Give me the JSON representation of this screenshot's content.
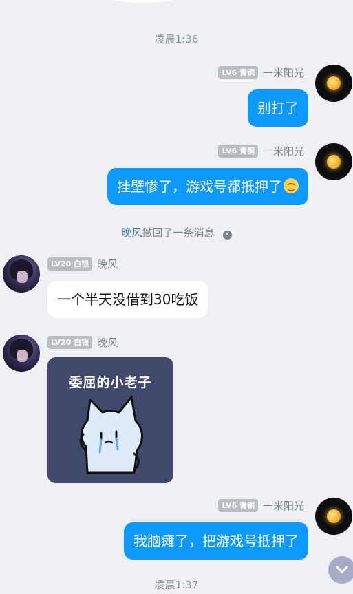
{
  "timestamps": [
    "凌晨1:36",
    "凌晨1:37"
  ],
  "recall_notice": {
    "actor": "晚风",
    "text": "撤回了一条消息"
  },
  "messages": [
    {
      "side": "right",
      "level": "LV6 青铜",
      "name": "一米阳光",
      "text": "别打了"
    },
    {
      "side": "right",
      "level": "LV6 青铜",
      "name": "一米阳光",
      "text": "挂壁惨了，游戏号都抵押了",
      "emoji": "smile-emoji"
    },
    {
      "side": "left",
      "level": "LV20 白银",
      "name": "晚风",
      "text": "一个半天没借到30吃饭"
    },
    {
      "side": "left",
      "level": "LV20 白银",
      "name": "晚风",
      "sticker_caption": "委屈的小老子"
    },
    {
      "side": "right",
      "level": "LV6 青铜",
      "name": "一米阳光",
      "text": "我脑瘫了，把游戏号抵押了"
    }
  ],
  "icons": {
    "scroll_down": "chevron-down-icon",
    "recall_close": "close-icon"
  },
  "colors": {
    "outgoing_bubble": "#0d99ff",
    "incoming_bubble": "#ffffff",
    "background": "#eef0f4",
    "badge": "#b9bcc3"
  }
}
